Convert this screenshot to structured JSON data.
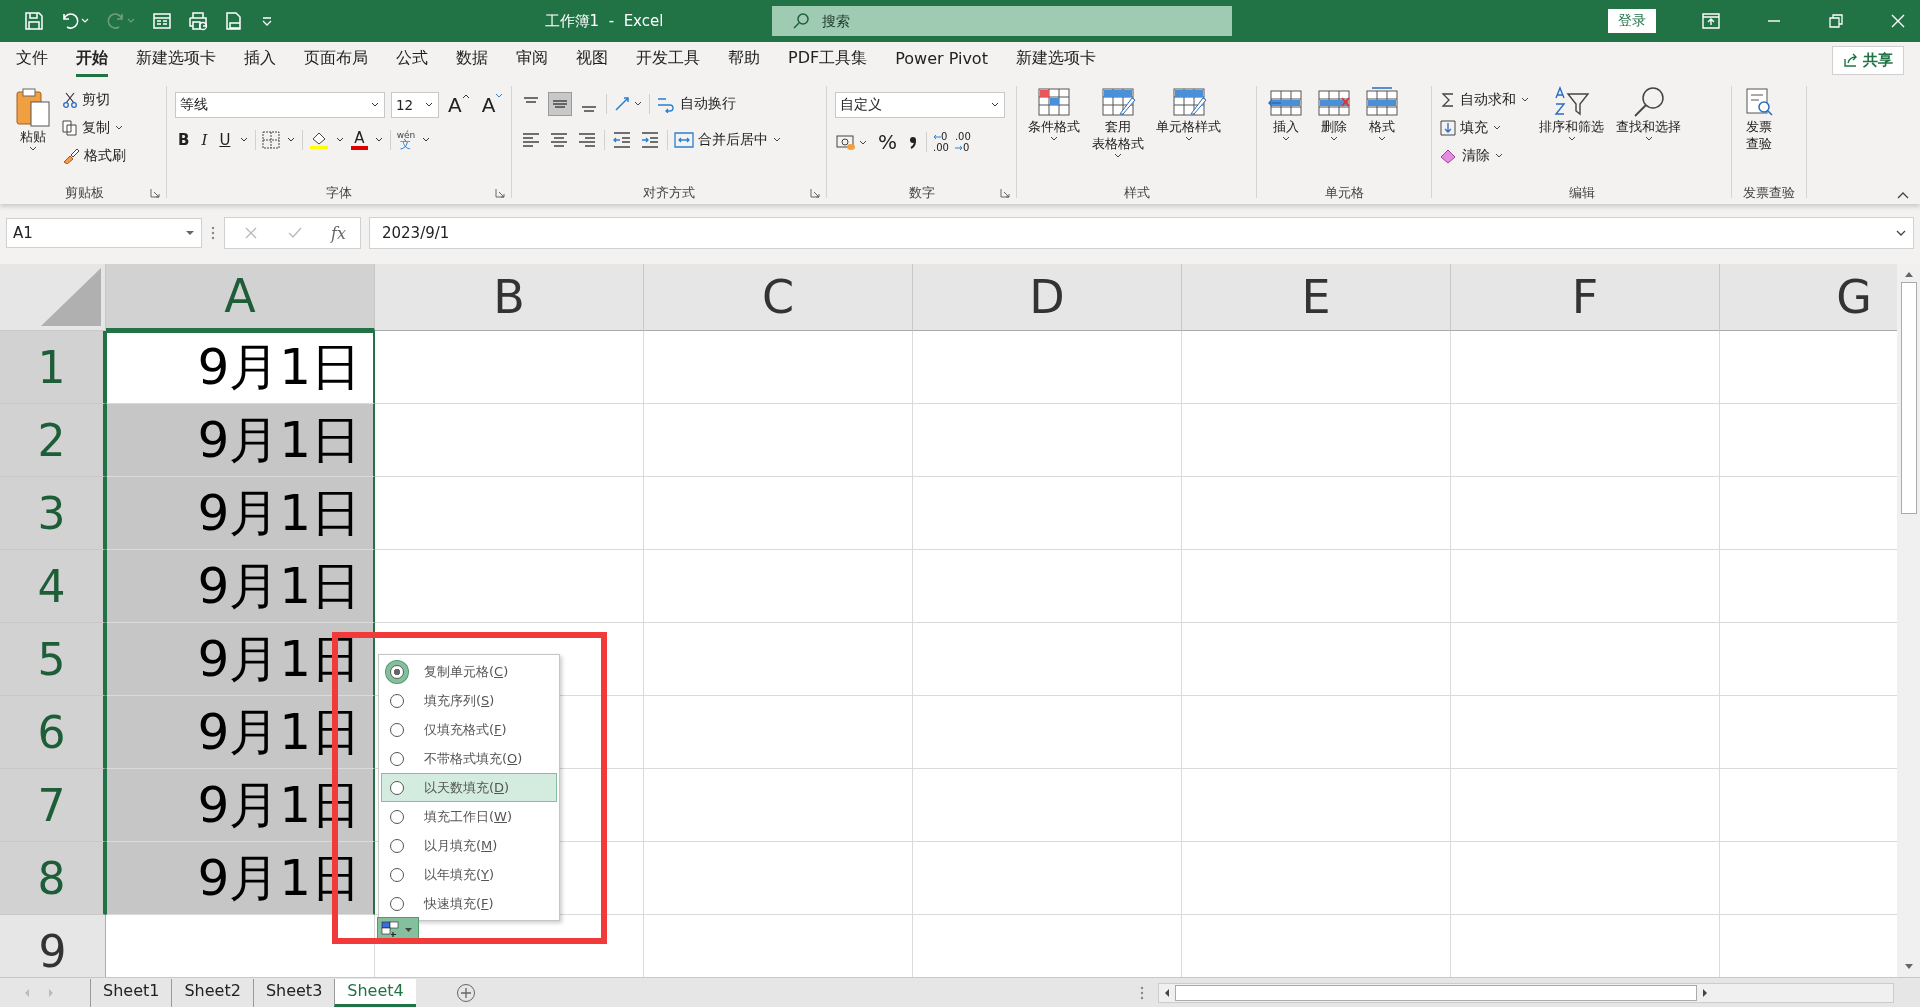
{
  "title_bar": {
    "title": "工作簿1  -  Excel",
    "search_placeholder": "搜索",
    "sign_in": "登录"
  },
  "menu_tabs": [
    {
      "label": "文件",
      "selected": false
    },
    {
      "label": "开始",
      "selected": true
    },
    {
      "label": "新建选项卡",
      "selected": false
    },
    {
      "label": "插入",
      "selected": false
    },
    {
      "label": "页面布局",
      "selected": false
    },
    {
      "label": "公式",
      "selected": false
    },
    {
      "label": "数据",
      "selected": false
    },
    {
      "label": "审阅",
      "selected": false
    },
    {
      "label": "视图",
      "selected": false
    },
    {
      "label": "开发工具",
      "selected": false
    },
    {
      "label": "帮助",
      "selected": false
    },
    {
      "label": "PDF工具集",
      "selected": false
    },
    {
      "label": "Power Pivot",
      "selected": false
    },
    {
      "label": "新建选项卡",
      "selected": false
    }
  ],
  "share": "共享",
  "clipboard": {
    "paste": "粘贴",
    "cut": "剪切",
    "copy": "复制",
    "painter": "格式刷",
    "label": "剪贴板"
  },
  "font": {
    "name": "等线",
    "size": "12",
    "grow": "A",
    "shrink": "A",
    "bold": "B",
    "italic": "I",
    "underline": "U",
    "color_letter": "A",
    "phonetic_top": "wén",
    "phonetic_bottom": "文",
    "label": "字体"
  },
  "alignment": {
    "wrap": "自动换行",
    "merge": "合并后居中",
    "label": "对齐方式"
  },
  "number": {
    "format": "自定义",
    "percent": "%",
    "decimal_more": [
      "0",
      ".00"
    ],
    "decimal_less": [
      ".00",
      "0"
    ],
    "label": "数字"
  },
  "styles": {
    "items": [
      {
        "lines": [
          "条件格式"
        ]
      },
      {
        "lines": [
          "套用",
          "表格格式"
        ]
      },
      {
        "lines": [
          "单元格样式"
        ]
      }
    ],
    "label": "样式"
  },
  "cells": {
    "items": [
      "插入",
      "删除",
      "格式"
    ],
    "label": "单元格"
  },
  "editing": {
    "autosum": "自动求和",
    "fill": "填充",
    "clear": "清除",
    "sort": "排序和筛选",
    "find": "查找和选择",
    "label": "编辑"
  },
  "invoice": {
    "lines": [
      "发票",
      "查验"
    ],
    "label": "发票查验"
  },
  "formula_bar": {
    "name_box": "A1",
    "fx": "fx",
    "formula": "2023/9/1"
  },
  "columns": [
    {
      "label": "A",
      "selected": true
    },
    {
      "label": "B",
      "selected": false
    },
    {
      "label": "C",
      "selected": false
    },
    {
      "label": "D",
      "selected": false
    },
    {
      "label": "E",
      "selected": false
    },
    {
      "label": "F",
      "selected": false
    },
    {
      "label": "G",
      "selected": false
    }
  ],
  "rows": [
    {
      "number": "1",
      "selected": true,
      "active": true,
      "value": "9月1日"
    },
    {
      "number": "2",
      "selected": true,
      "active": false,
      "value": "9月1日"
    },
    {
      "number": "3",
      "selected": true,
      "active": false,
      "value": "9月1日"
    },
    {
      "number": "4",
      "selected": true,
      "active": false,
      "value": "9月1日"
    },
    {
      "number": "5",
      "selected": true,
      "active": false,
      "value": "9月1日"
    },
    {
      "number": "6",
      "selected": true,
      "active": false,
      "value": "9月1日"
    },
    {
      "number": "7",
      "selected": true,
      "active": false,
      "value": "9月1日"
    },
    {
      "number": "8",
      "selected": true,
      "active": false,
      "value": "9月1日"
    },
    {
      "number": "9",
      "selected": false,
      "active": false
    }
  ],
  "fill_options": [
    {
      "pre": "复制单元格(",
      "key": "C",
      "post": ")",
      "checked": true,
      "hovered": false
    },
    {
      "pre": "填充序列(",
      "key": "S",
      "post": ")",
      "checked": false,
      "hovered": false
    },
    {
      "pre": "仅填充格式(",
      "key": "F",
      "post": ")",
      "checked": false,
      "hovered": false
    },
    {
      "pre": "不带格式填充(",
      "key": "O",
      "post": ")",
      "checked": false,
      "hovered": false
    },
    {
      "pre": "以天数填充(",
      "key": "D",
      "post": ")",
      "checked": false,
      "hovered": true
    },
    {
      "pre": "填充工作日(",
      "key": "W",
      "post": ")",
      "checked": false,
      "hovered": false
    },
    {
      "pre": "以月填充(",
      "key": "M",
      "post": ")",
      "checked": false,
      "hovered": false
    },
    {
      "pre": "以年填充(",
      "key": "Y",
      "post": ")",
      "checked": false,
      "hovered": false
    },
    {
      "pre": "快速填充(",
      "key": "F",
      "post": ")",
      "checked": false,
      "hovered": false
    }
  ],
  "sheet_tabs": [
    {
      "label": "Sheet1",
      "selected": false
    },
    {
      "label": "Sheet2",
      "selected": false
    },
    {
      "label": "Sheet3",
      "selected": false
    },
    {
      "label": "Sheet4",
      "selected": true
    }
  ]
}
